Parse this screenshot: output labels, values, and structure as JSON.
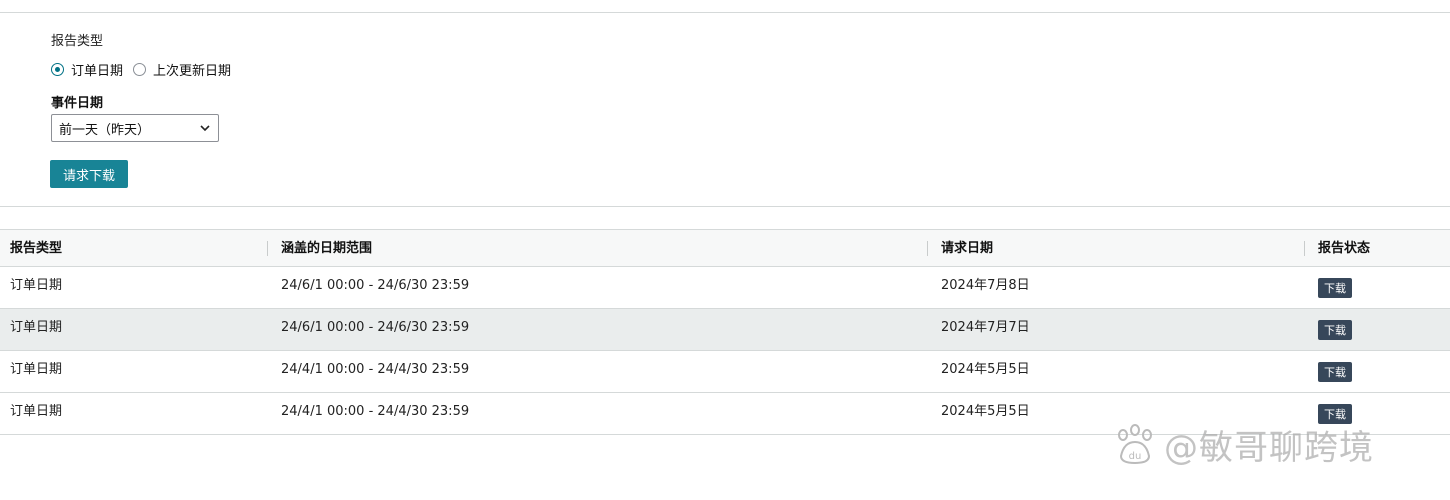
{
  "form": {
    "report_type_label": "报告类型",
    "radio_options": [
      {
        "label": "订单日期",
        "checked": true
      },
      {
        "label": "上次更新日期",
        "checked": false
      }
    ],
    "event_date_label": "事件日期",
    "event_date_select": {
      "value": "前一天（昨天）"
    },
    "request_button": "请求下载"
  },
  "table": {
    "headers": [
      "报告类型",
      "涵盖的日期范围",
      "请求日期",
      "报告状态"
    ],
    "rows": [
      {
        "type": "订单日期",
        "range": "24/6/1 00:00 - 24/6/30 23:59",
        "requested": "2024年7月8日",
        "status": "下载"
      },
      {
        "type": "订单日期",
        "range": "24/6/1 00:00 - 24/6/30 23:59",
        "requested": "2024年7月7日",
        "status": "下载"
      },
      {
        "type": "订单日期",
        "range": "24/4/1 00:00 - 24/4/30 23:59",
        "requested": "2024年5月5日",
        "status": "下载"
      },
      {
        "type": "订单日期",
        "range": "24/4/1 00:00 - 24/4/30 23:59",
        "requested": "2024年5月5日",
        "status": "下载"
      }
    ]
  },
  "watermark": {
    "text": "@敏哥聊跨境",
    "logo_text": "du"
  },
  "colors": {
    "accent": "#188496",
    "badge": "#37475a",
    "alt_row": "#eaeded"
  }
}
